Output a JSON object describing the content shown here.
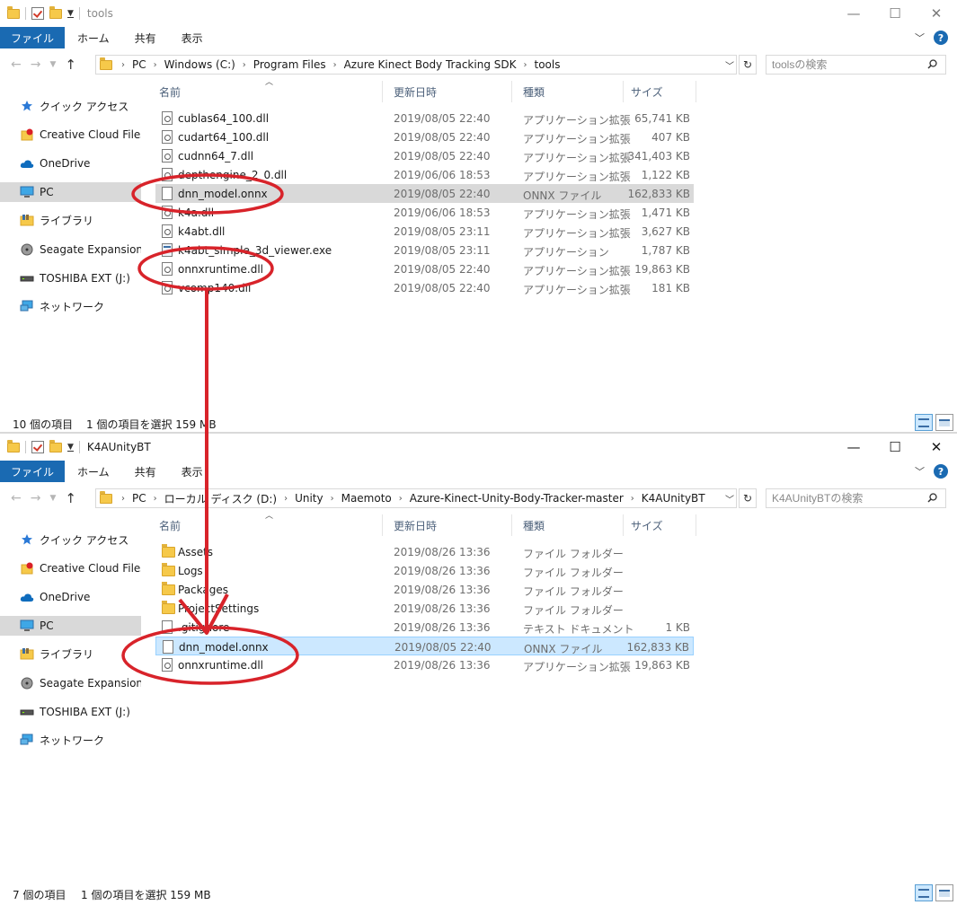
{
  "ribbon": {
    "file": "ファイル",
    "home": "ホーム",
    "share": "共有",
    "view": "表示"
  },
  "columns": {
    "name": "名前",
    "date": "更新日時",
    "type": "種類",
    "size": "サイズ"
  },
  "sidebar": [
    {
      "label": "クイック アクセス",
      "icon": "star-icon"
    },
    {
      "label": "Creative Cloud Files",
      "icon": "creative-cloud-icon"
    },
    {
      "label": "OneDrive",
      "icon": "cloud-icon"
    },
    {
      "label": "PC",
      "icon": "pc-icon"
    },
    {
      "label": "ライブラリ",
      "icon": "library-icon"
    },
    {
      "label": "Seagate Expansion Dr",
      "icon": "drive-icon"
    },
    {
      "label": "TOSHIBA EXT (J:)",
      "icon": "usb-drive-icon"
    },
    {
      "label": "ネットワーク",
      "icon": "network-icon"
    }
  ],
  "window1": {
    "title": "tools",
    "breadcrumb": [
      "PC",
      "Windows (C:)",
      "Program Files",
      "Azure Kinect Body Tracking SDK",
      "tools"
    ],
    "search_placeholder": "toolsの検索",
    "files": [
      {
        "name": "cublas64_100.dll",
        "date": "2019/08/05 22:40",
        "type": "アプリケーション拡張",
        "size": "65,741 KB",
        "icon": "dll"
      },
      {
        "name": "cudart64_100.dll",
        "date": "2019/08/05 22:40",
        "type": "アプリケーション拡張",
        "size": "407 KB",
        "icon": "dll"
      },
      {
        "name": "cudnn64_7.dll",
        "date": "2019/08/05 22:40",
        "type": "アプリケーション拡張",
        "size": "341,403 KB",
        "icon": "dll"
      },
      {
        "name": "depthengine_2_0.dll",
        "date": "2019/06/06 18:53",
        "type": "アプリケーション拡張",
        "size": "1,122 KB",
        "icon": "dll"
      },
      {
        "name": "dnn_model.onnx",
        "date": "2019/08/05 22:40",
        "type": "ONNX ファイル",
        "size": "162,833 KB",
        "icon": "file"
      },
      {
        "name": "k4a.dll",
        "date": "2019/06/06 18:53",
        "type": "アプリケーション拡張",
        "size": "1,471 KB",
        "icon": "dll"
      },
      {
        "name": "k4abt.dll",
        "date": "2019/08/05 23:11",
        "type": "アプリケーション拡張",
        "size": "3,627 KB",
        "icon": "dll"
      },
      {
        "name": "k4abt_simple_3d_viewer.exe",
        "date": "2019/08/05 23:11",
        "type": "アプリケーション",
        "size": "1,787 KB",
        "icon": "exe"
      },
      {
        "name": "onnxruntime.dll",
        "date": "2019/08/05 22:40",
        "type": "アプリケーション拡張",
        "size": "19,863 KB",
        "icon": "dll"
      },
      {
        "name": "vcomp140.dll",
        "date": "2019/08/05 22:40",
        "type": "アプリケーション拡張",
        "size": "181 KB",
        "icon": "dll"
      }
    ],
    "status_count": "10 個の項目",
    "status_selection": "1 個の項目を選択  159 MB"
  },
  "window2": {
    "title": "K4AUnityBT",
    "breadcrumb": [
      "PC",
      "ローカル ディスク (D:)",
      "Unity",
      "Maemoto",
      "Azure-Kinect-Unity-Body-Tracker-master",
      "K4AUnityBT"
    ],
    "search_placeholder": "K4AUnityBTの検索",
    "files": [
      {
        "name": "Assets",
        "date": "2019/08/26 13:36",
        "type": "ファイル フォルダー",
        "size": "",
        "icon": "folder"
      },
      {
        "name": "Logs",
        "date": "2019/08/26 13:36",
        "type": "ファイル フォルダー",
        "size": "",
        "icon": "folder"
      },
      {
        "name": "Packages",
        "date": "2019/08/26 13:36",
        "type": "ファイル フォルダー",
        "size": "",
        "icon": "folder"
      },
      {
        "name": "ProjectSettings",
        "date": "2019/08/26 13:36",
        "type": "ファイル フォルダー",
        "size": "",
        "icon": "folder"
      },
      {
        "name": ".gitignore",
        "date": "2019/08/26 13:36",
        "type": "テキスト ドキュメント",
        "size": "1 KB",
        "icon": "file"
      },
      {
        "name": "dnn_model.onnx",
        "date": "2019/08/05 22:40",
        "type": "ONNX ファイル",
        "size": "162,833 KB",
        "icon": "file"
      },
      {
        "name": "onnxruntime.dll",
        "date": "2019/08/26 13:36",
        "type": "アプリケーション拡張",
        "size": "19,863 KB",
        "icon": "dll"
      }
    ],
    "status_count": "7 個の項目",
    "status_selection": "1 個の項目を選択  159 MB"
  },
  "colors": {
    "accent": "#1a6ab2",
    "annotation": "#d8232a",
    "selection_blue": "#cce8ff",
    "selection_grey": "#d9d9d9"
  }
}
